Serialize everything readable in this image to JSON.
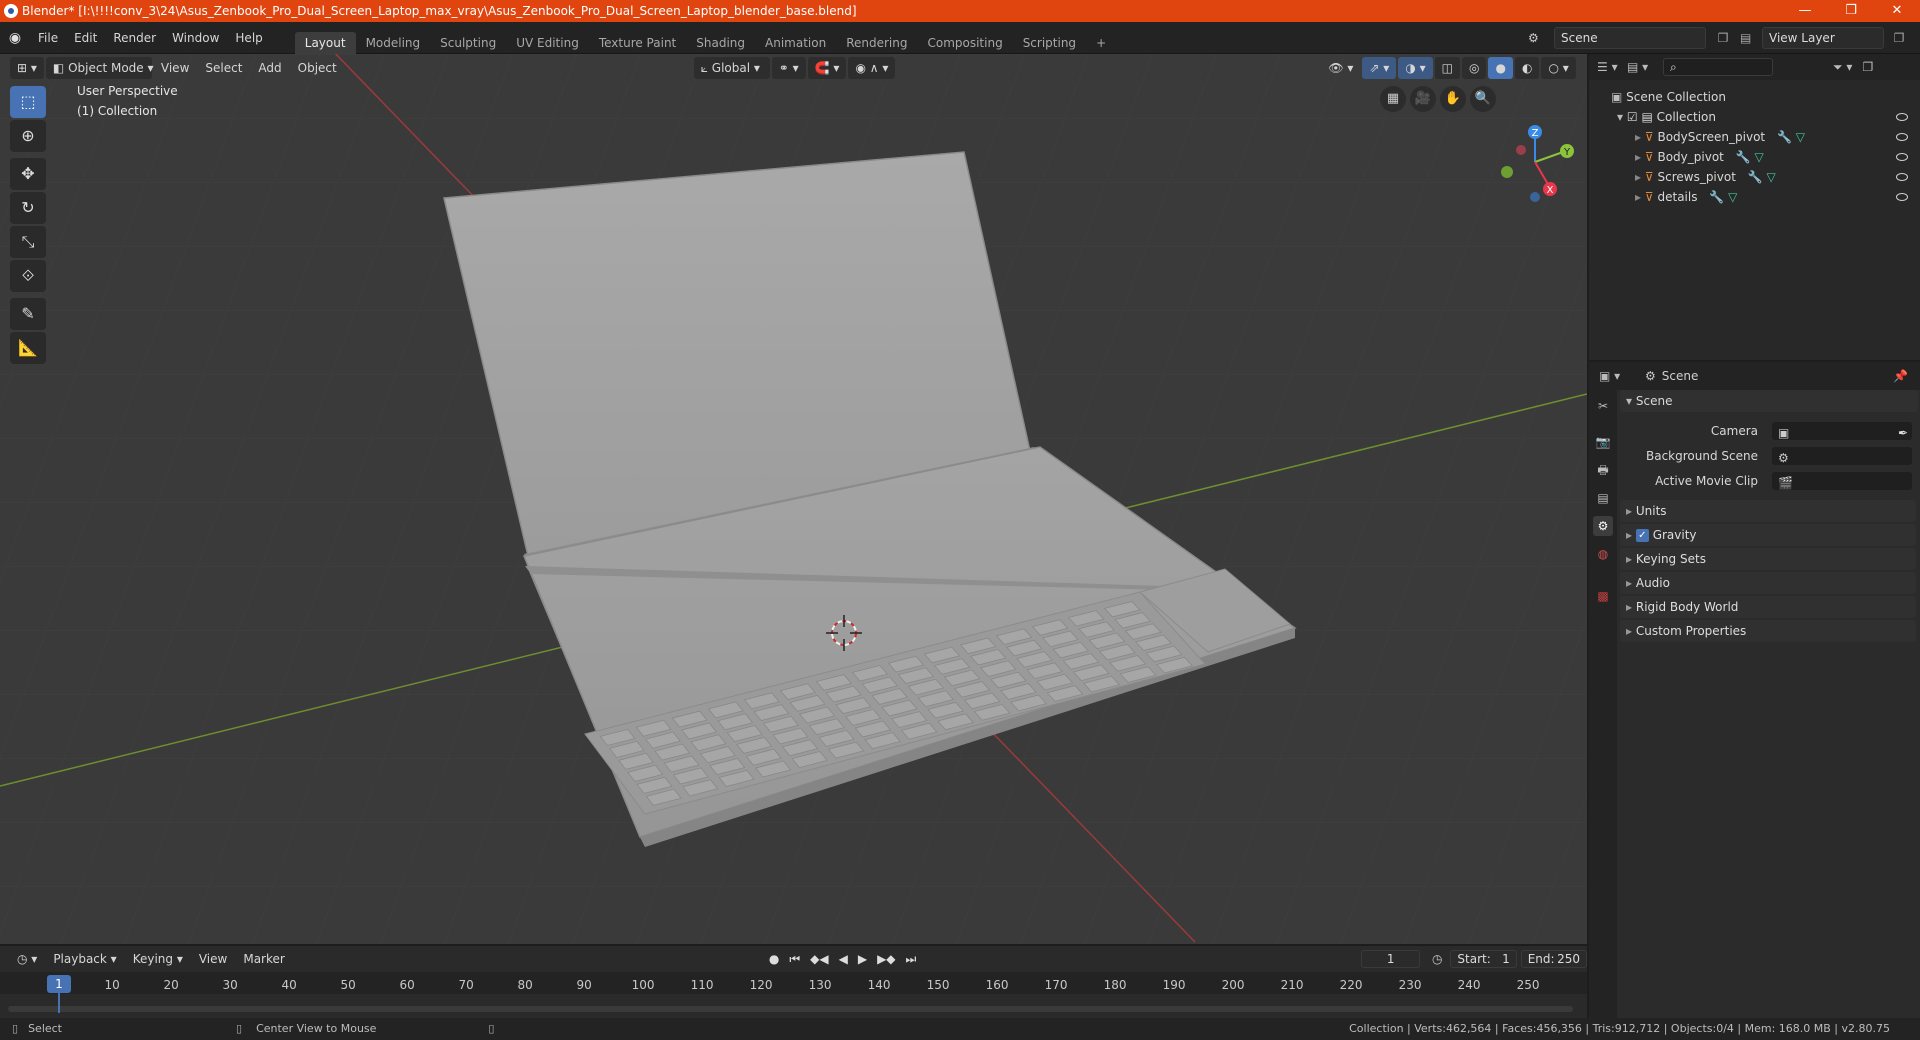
{
  "window": {
    "title": "Blender* [I:\\!!!!conv_3\\24\\Asus_Zenbook_Pro_Dual_Screen_Laptop_max_vray\\Asus_Zenbook_Pro_Dual_Screen_Laptop_blender_base.blend]",
    "minimize": "—",
    "maximize": "❐",
    "close": "✕"
  },
  "menubar": {
    "menus": [
      "File",
      "Edit",
      "Render",
      "Window",
      "Help"
    ],
    "workspaces": [
      "Layout",
      "Modeling",
      "Sculpting",
      "UV Editing",
      "Texture Paint",
      "Shading",
      "Animation",
      "Rendering",
      "Compositing",
      "Scripting"
    ],
    "active_workspace": "Layout",
    "add_workspace": "+",
    "scene": "Scene",
    "view_layer": "View Layer"
  },
  "viewport": {
    "mode": "Object Mode",
    "menus": [
      "View",
      "Select",
      "Add",
      "Object"
    ],
    "transform_orientation": "Global",
    "perspective_label": "User Perspective",
    "collection_label": "(1) Collection",
    "gizmo": {
      "x": "X",
      "y": "Y",
      "z": "Z"
    }
  },
  "outliner": {
    "search_placeholder": "",
    "root": "Scene Collection",
    "collection": "Collection",
    "items": [
      "BodyScreen_pivot",
      "Body_pivot",
      "Screws_pivot",
      "details"
    ]
  },
  "properties": {
    "context": "Scene",
    "scene_panel": "Scene",
    "camera_label": "Camera",
    "background_scene_label": "Background Scene",
    "active_movie_clip_label": "Active Movie Clip",
    "panels": [
      "Units",
      "Gravity",
      "Keying Sets",
      "Audio",
      "Rigid Body World",
      "Custom Properties"
    ],
    "gravity_enabled": true
  },
  "timeline": {
    "menus": [
      "Playback",
      "Keying",
      "View",
      "Marker"
    ],
    "current_frame": "1",
    "start_label": "Start:",
    "start": "1",
    "end_label": "End:",
    "end": "250",
    "ruler": [
      "1",
      "10",
      "20",
      "30",
      "40",
      "50",
      "60",
      "70",
      "80",
      "90",
      "100",
      "110",
      "120",
      "130",
      "140",
      "150",
      "160",
      "170",
      "180",
      "190",
      "200",
      "210",
      "220",
      "230",
      "240",
      "250"
    ]
  },
  "status": {
    "select": "Select",
    "center_view": "Center View to Mouse",
    "stats": "Collection | Verts:462,564 | Faces:456,356 | Tris:912,712 | Objects:0/4 | Mem: 168.0 MB | v2.80.75"
  },
  "colors": {
    "title_bar": "#e0450f",
    "accent": "#4772b3",
    "axis_x": "#e8364a",
    "axis_y": "#8bc33a",
    "axis_z": "#3a8be8"
  }
}
